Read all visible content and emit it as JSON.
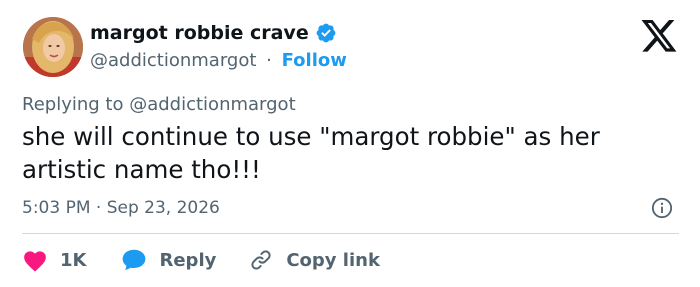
{
  "author": {
    "display_name": "margot robbie crave",
    "handle": "@addictionmargot",
    "separator": "·",
    "follow_label": "Follow",
    "verified_color": "#1d9bf0"
  },
  "reply_context": {
    "prefix": "Replying to",
    "handle": "@addictionmargot"
  },
  "tweet": {
    "text": "she will continue to use \"margot robbie\" as her artistic name tho!!!",
    "timestamp": "5:03 PM · Sep 23, 2026"
  },
  "actions": {
    "like_count": "1K",
    "like_color": "#f91880",
    "reply_label": "Reply",
    "reply_color": "#1d9bf0",
    "copy_link_label": "Copy link"
  },
  "icons": {
    "brand": "x-logo-icon",
    "info": "info-icon",
    "like": "heart-icon",
    "reply": "speech-bubble-icon",
    "copy": "link-icon"
  }
}
